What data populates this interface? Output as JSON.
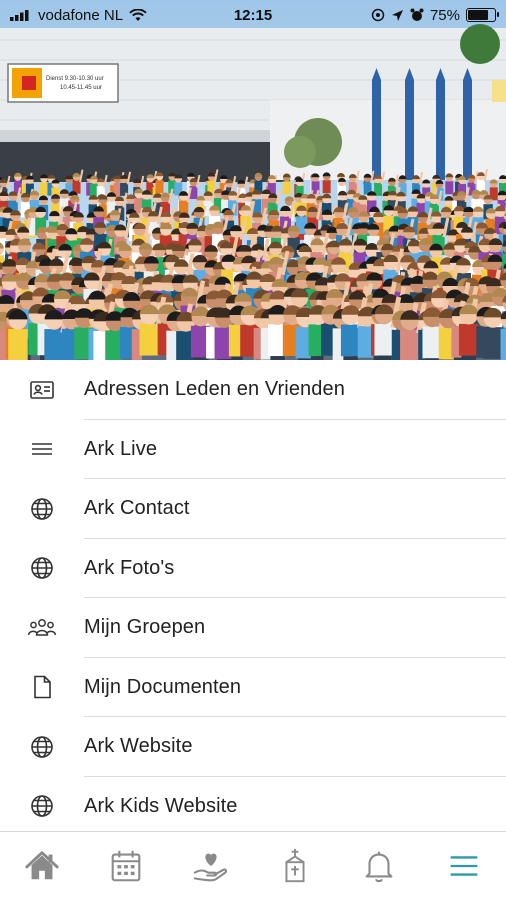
{
  "status_bar": {
    "carrier": "vodafone NL",
    "time": "12:15",
    "battery_percent": "75%",
    "battery_level": 0.75,
    "icons": [
      "signal-icon",
      "wifi-icon",
      "location-icon",
      "alarm-icon",
      "battery-icon"
    ]
  },
  "hero": {
    "description_icon": "crowd-photo",
    "sign_lines": [
      "Dienst 9.30-10.30 uur",
      "10.45-11.45 uur"
    ]
  },
  "menu": {
    "items": [
      {
        "label": "Adressen Leden en Vrienden",
        "icon": "contact-card-icon"
      },
      {
        "label": "Ark Live",
        "icon": "hamburger-lines-icon"
      },
      {
        "label": "Ark Contact",
        "icon": "globe-icon"
      },
      {
        "label": "Ark Foto's",
        "icon": "globe-icon"
      },
      {
        "label": "Mijn Groepen",
        "icon": "group-icon"
      },
      {
        "label": "Mijn Documenten",
        "icon": "document-icon"
      },
      {
        "label": "Ark Website",
        "icon": "globe-icon"
      },
      {
        "label": "Ark Kids Website",
        "icon": "globe-icon"
      }
    ]
  },
  "tab_bar": {
    "tabs": [
      {
        "name": "home",
        "icon": "home-icon"
      },
      {
        "name": "calendar",
        "icon": "calendar-icon"
      },
      {
        "name": "give",
        "icon": "hand-heart-icon"
      },
      {
        "name": "church",
        "icon": "church-icon"
      },
      {
        "name": "notifications",
        "icon": "bell-icon"
      },
      {
        "name": "menu",
        "icon": "menu-icon",
        "active": true
      }
    ]
  },
  "colors": {
    "accent": "#2a9aa8",
    "inactive_icon": "#8a8a8a",
    "divider": "#dcdcdc"
  }
}
